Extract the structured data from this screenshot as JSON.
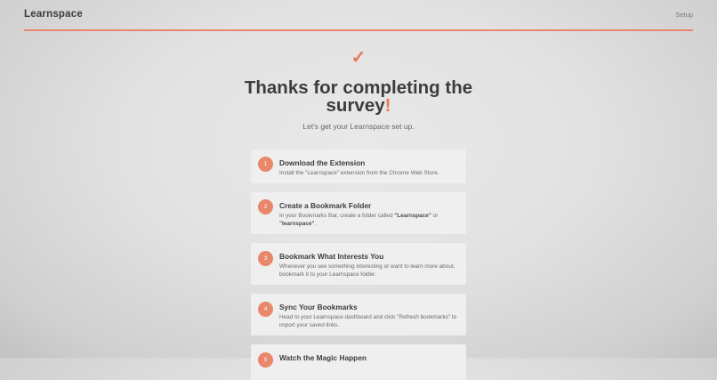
{
  "header": {
    "logo": "Learnspace",
    "setup_link": "Setup"
  },
  "hero": {
    "check": "✓",
    "title_line1": "Thanks for completing the",
    "title_line2": "survey",
    "title_bang": "!",
    "subtitle": "Let's get your Learnspace set up."
  },
  "steps": [
    {
      "number": "1",
      "title": "Download the Extension",
      "desc": "Install the \"Learnspace\" extension from the Chrome Web Store."
    },
    {
      "number": "2",
      "title": "Create a Bookmark Folder",
      "desc_prefix": "In your Bookmarks Bar, create a folder called ",
      "desc_bold1": "\"Learnspace\"",
      "desc_mid": " or ",
      "desc_bold2": "\"learnspace\"",
      "desc_suffix": "."
    },
    {
      "number": "3",
      "title": "Bookmark What Interests You",
      "desc": "Whenever you see something interesting or want to learn more about, bookmark it to your Learnspace folder."
    },
    {
      "number": "4",
      "title": "Sync Your Bookmarks",
      "desc": "Head to your Learnspace dashboard and click \"Refresh bookmarks\" to import your saved links."
    },
    {
      "number": "5",
      "title": "Watch the Magic Happen"
    }
  ],
  "colors": {
    "accent": "#e8785a",
    "accent_soft": "#e8876a"
  }
}
